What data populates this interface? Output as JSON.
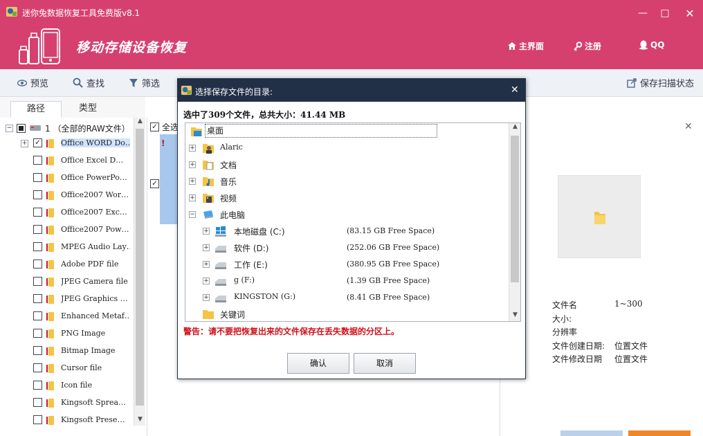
{
  "window": {
    "title": "迷你兔数据恢复工具免费版v8.1",
    "minimize_glyph": "—",
    "maximize_glyph": "□",
    "close_glyph": "✕"
  },
  "header": {
    "title": "移动存储设备恢复",
    "nav": [
      {
        "label": "主界面",
        "icon": "home-icon"
      },
      {
        "label": "注册",
        "icon": "key-icon"
      },
      {
        "label": "QQ",
        "icon": "qq-icon"
      }
    ],
    "colors": {
      "brand": "#d6406f",
      "dialog_title": "#223047",
      "warning": "#d0111b"
    }
  },
  "toolbar": {
    "preview": "预览",
    "find": "查找",
    "filter": "筛选",
    "save_scan": "保存扫描状态"
  },
  "tabs": {
    "path": "路径",
    "type": "类型"
  },
  "tree": {
    "root_label": "1  （全部的RAW文件）",
    "items": [
      {
        "label": "Office WORD Do…",
        "checked": true,
        "selected": true
      },
      {
        "label": "Office Excel D…",
        "checked": false
      },
      {
        "label": "Office PowerPo…",
        "checked": false
      },
      {
        "label": "Office2007 Wor…",
        "checked": false
      },
      {
        "label": "Office2007 Exc…",
        "checked": false
      },
      {
        "label": "Office2007 Pow…",
        "checked": false
      },
      {
        "label": "MPEG Audio Lay…",
        "checked": false
      },
      {
        "label": "Adobe PDF file",
        "checked": false
      },
      {
        "label": "JPEG Camera file",
        "checked": false
      },
      {
        "label": "JPEG Graphics …",
        "checked": false
      },
      {
        "label": "Enhanced Metaf…",
        "checked": false
      },
      {
        "label": "PNG Image",
        "checked": false
      },
      {
        "label": "Bitmap Image",
        "checked": false
      },
      {
        "label": "Cursor file",
        "checked": false
      },
      {
        "label": "Icon file",
        "checked": false
      },
      {
        "label": "Kingsoft Sprea…",
        "checked": false
      },
      {
        "label": "Kingsoft Prese…",
        "checked": false
      }
    ]
  },
  "middle": {
    "select_all": "全选",
    "warn_mark": "!"
  },
  "details": {
    "close": "✕",
    "rows": [
      {
        "key": "文件名",
        "value": "1~300"
      },
      {
        "key": "大小:",
        "value": ""
      },
      {
        "key": "分辨率",
        "value": ""
      },
      {
        "key": "文件创建日期:",
        "value": "位置文件"
      },
      {
        "key": "文件修改日期",
        "value": "位置文件"
      }
    ]
  },
  "dialog": {
    "title": "选择保存文件的目录:",
    "close": "✕",
    "summary_prefix": "选中了",
    "file_count": "309",
    "summary_mid": "个文件，总共大小：",
    "total_size": "41.44 MB",
    "folders": {
      "desktop": "桌面",
      "alaric": "Alaric",
      "documents": "文档",
      "music": "音乐",
      "videos": "视频",
      "this_pc": "此电脑",
      "keyword": "关键词"
    },
    "drives": [
      {
        "name": "本地磁盘 (C:)",
        "space": "(83.15 GB Free Space)"
      },
      {
        "name": "软件 (D:)",
        "space": "(252.06 GB Free Space)"
      },
      {
        "name": "工作 (E:)",
        "space": "(380.95 GB Free Space)"
      },
      {
        "name": "g (F:)",
        "space": "(1.39 GB Free Space)"
      },
      {
        "name": "KINGSTON (G:)",
        "space": "(8.41 GB Free Space)"
      }
    ],
    "warning": "警告：请不要把恢复出来的文件保存在丢失数据的分区上。",
    "ok": "确认",
    "cancel": "取消"
  }
}
